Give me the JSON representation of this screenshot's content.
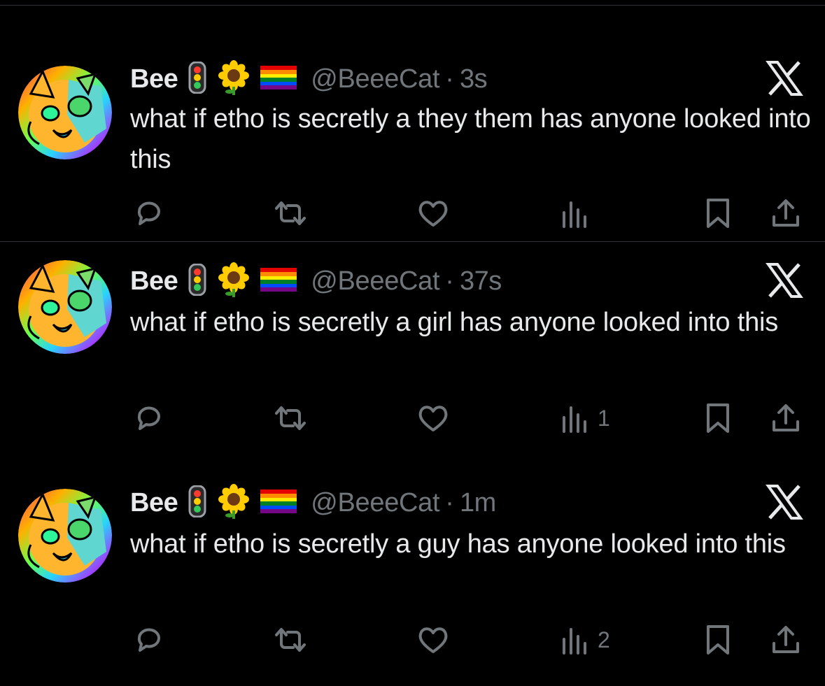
{
  "colors": {
    "background": "#000000",
    "text": "#e7e9ea",
    "muted": "#71767b",
    "divider": "#2f3336"
  },
  "tweets": [
    {
      "display_name": "Bee",
      "emojis": [
        "traffic-light",
        "sunflower",
        "rainbow-flag"
      ],
      "handle": "@BeeeCat",
      "separator": "·",
      "time": "3s",
      "text": "what if etho is secretly a they them has anyone looked into this",
      "views": ""
    },
    {
      "display_name": "Bee",
      "emojis": [
        "traffic-light",
        "sunflower",
        "rainbow-flag"
      ],
      "handle": "@BeeeCat",
      "separator": "·",
      "time": "37s",
      "text": "what if etho is secretly a girl has anyone looked into this",
      "views": "1"
    },
    {
      "display_name": "Bee",
      "emojis": [
        "traffic-light",
        "sunflower",
        "rainbow-flag"
      ],
      "handle": "@BeeeCat",
      "separator": "·",
      "time": "1m",
      "text": "what if etho is secretly a guy has anyone looked into this",
      "views": "2"
    }
  ],
  "icons": {
    "logo": "x-logo-icon",
    "reply": "reply-bubble-icon",
    "repost": "repost-arrows-icon",
    "like": "heart-icon",
    "views": "bar-chart-icon",
    "bookmark": "bookmark-icon",
    "share": "share-upload-icon"
  }
}
